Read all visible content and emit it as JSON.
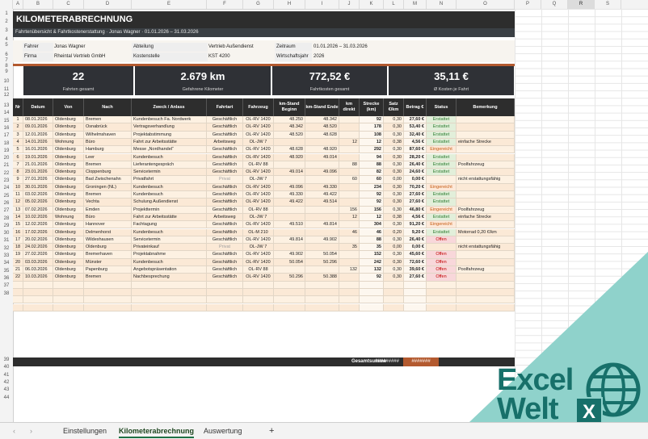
{
  "columns": [
    "A",
    "B",
    "C",
    "D",
    "E",
    "F",
    "G",
    "H",
    "I",
    "J",
    "K",
    "L",
    "M",
    "N",
    "O",
    "P",
    "Q",
    "R",
    "S"
  ],
  "selected_column": "R",
  "row_numbers": [
    "1",
    "2",
    "3",
    "4",
    "5",
    "6",
    "7",
    "8",
    "9",
    "10",
    "11",
    "12",
    "13",
    "14",
    "15",
    "16",
    "17",
    "18",
    "19",
    "20",
    "21",
    "22",
    "23",
    "24",
    "25",
    "26",
    "27",
    "28",
    "29",
    "30",
    "31",
    "32",
    "33",
    "34",
    "35",
    "36",
    "37",
    "38",
    "39",
    "40",
    "41",
    "42",
    "43",
    "44"
  ],
  "title": "KILOMETERABRECHNUNG",
  "subtitle": "Fahrtenübersicht & Fahrtkostenerstattung · Jonas Wagner · 01.01.2026 – 31.03.2026",
  "meta": {
    "fahrer_label": "Fahrer",
    "fahrer": "Jonas Wagner",
    "firma_label": "Firma",
    "firma": "Rheintal Vertrieb GmbH",
    "abteilung_label": "Abteilung",
    "abteilung": "Vertrieb Außendienst",
    "kostenstelle_label": "Kostenstelle",
    "kostenstelle": "KST 4200",
    "zeitraum_label": "Zeitraum",
    "zeitraum": "01.01.2026 – 31.03.2026",
    "wirtschaftsjahr_label": "Wirtschaftsjahr",
    "wirtschaftsjahr": "2026"
  },
  "kpis": [
    {
      "value": "22",
      "label": "Fahrten gesamt"
    },
    {
      "value": "2.679 km",
      "label": "Gefahrene Kilometer"
    },
    {
      "value": "772,52 €",
      "label": "Fahrtkosten gesamt"
    },
    {
      "value": "35,11 €",
      "label": "Ø Kosten je Fahrt"
    }
  ],
  "headers": [
    "Nr",
    "Datum",
    "Von",
    "Nach",
    "Zweck / Anlass",
    "Fahrtart",
    "Fahrzeug",
    "km-Stand Beginn",
    "km-Stand Ende",
    "km direkt",
    "Strecke (km)",
    "Satz €/km",
    "Betrag €",
    "Status",
    "Bemerkung"
  ],
  "rows": [
    [
      "1",
      "08.01.2026",
      "Oldenburg",
      "Bremen",
      "Kundenbesuch Fa. Nordwerk",
      "Geschäftlich",
      "OL-RV 1420",
      "48.250",
      "48.342",
      "",
      "92",
      "0,30",
      "27,60 €",
      "Erstattet",
      ""
    ],
    [
      "2",
      "09.01.2026",
      "Oldenburg",
      "Osnabrück",
      "Vertragsverhandlung",
      "Geschäftlich",
      "OL-RV 1420",
      "48.342",
      "48.520",
      "",
      "178",
      "0,30",
      "53,40 €",
      "Erstattet",
      ""
    ],
    [
      "3",
      "12.01.2026",
      "Oldenburg",
      "Wilhelmshaven",
      "Projektabstimmung",
      "Geschäftlich",
      "OL-RV 1420",
      "48.520",
      "48.628",
      "",
      "108",
      "0,30",
      "32,40 €",
      "Erstattet",
      ""
    ],
    [
      "4",
      "14.01.2026",
      "Wohnung",
      "Büro",
      "Fahrt zur Arbeitsstätte",
      "Arbeitsweg",
      "OL-JW 7",
      "",
      "",
      "12",
      "12",
      "0,38",
      "4,56 €",
      "Erstattet",
      "einfache Strecke"
    ],
    [
      "5",
      "16.01.2026",
      "Oldenburg",
      "Hamburg",
      "Messe „Nordhandel“",
      "Geschäftlich",
      "OL-RV 1420",
      "48.628",
      "48.920",
      "",
      "292",
      "0,30",
      "87,60 €",
      "Eingereicht",
      ""
    ],
    [
      "6",
      "19.01.2026",
      "Oldenburg",
      "Leer",
      "Kundenbesuch",
      "Geschäftlich",
      "OL-RV 1420",
      "48.920",
      "49.014",
      "",
      "94",
      "0,30",
      "28,20 €",
      "Erstattet",
      ""
    ],
    [
      "7",
      "21.01.2026",
      "Oldenburg",
      "Bremen",
      "Lieferantengespräch",
      "Geschäftlich",
      "OL-RV 88",
      "",
      "",
      "88",
      "88",
      "0,30",
      "26,40 €",
      "Erstattet",
      "Poolfahrzeug"
    ],
    [
      "8",
      "23.01.2026",
      "Oldenburg",
      "Cloppenburg",
      "Servicetermin",
      "Geschäftlich",
      "OL-RV 1420",
      "49.014",
      "49.096",
      "",
      "82",
      "0,30",
      "24,60 €",
      "Erstattet",
      ""
    ],
    [
      "9",
      "27.01.2026",
      "Oldenburg",
      "Bad Zwischenahn",
      "Privatfahrt",
      "Privat",
      "OL-JW 7",
      "",
      "",
      "60",
      "60",
      "0,00",
      "0,00 €",
      "",
      "nicht erstattungsfähig"
    ],
    [
      "10",
      "30.01.2026",
      "Oldenburg",
      "Groningen (NL)",
      "Kundenbesuch",
      "Geschäftlich",
      "OL-RV 1420",
      "49.096",
      "49.330",
      "",
      "234",
      "0,30",
      "70,20 €",
      "Eingereicht",
      ""
    ],
    [
      "11",
      "03.02.2026",
      "Oldenburg",
      "Bremen",
      "Kundenbesuch",
      "Geschäftlich",
      "OL-RV 1420",
      "49.330",
      "49.422",
      "",
      "92",
      "0,30",
      "27,60 €",
      "Erstattet",
      ""
    ],
    [
      "12",
      "05.02.2026",
      "Oldenburg",
      "Vechta",
      "Schulung Außendienst",
      "Geschäftlich",
      "OL-RV 1420",
      "49.422",
      "49.514",
      "",
      "92",
      "0,30",
      "27,60 €",
      "Erstattet",
      ""
    ],
    [
      "13",
      "07.02.2026",
      "Oldenburg",
      "Emden",
      "Projekttermin",
      "Geschäftlich",
      "OL-RV 88",
      "",
      "",
      "156",
      "156",
      "0,30",
      "46,80 €",
      "Eingereicht",
      "Poolfahrzeug"
    ],
    [
      "14",
      "10.02.2026",
      "Wohnung",
      "Büro",
      "Fahrt zur Arbeitsstätte",
      "Arbeitsweg",
      "OL-JW 7",
      "",
      "",
      "12",
      "12",
      "0,38",
      "4,56 €",
      "Erstattet",
      "einfache Strecke"
    ],
    [
      "15",
      "12.02.2026",
      "Oldenburg",
      "Hannover",
      "Fachtagung",
      "Geschäftlich",
      "OL-RV 1420",
      "49.510",
      "49.814",
      "",
      "304",
      "0,30",
      "91,20 €",
      "Eingereicht",
      ""
    ],
    [
      "16",
      "17.02.2026",
      "Oldenburg",
      "Delmenhorst",
      "Kundenbesuch",
      "Geschäftlich",
      "OL-M 210",
      "",
      "",
      "46",
      "46",
      "0,20",
      "9,20 €",
      "Erstattet",
      "Motorrad 0,20 €/km"
    ],
    [
      "17",
      "20.02.2026",
      "Oldenburg",
      "Wildeshausen",
      "Servicetermin",
      "Geschäftlich",
      "OL-RV 1420",
      "49.814",
      "49.902",
      "",
      "88",
      "0,30",
      "26,40 €",
      "Offen",
      ""
    ],
    [
      "18",
      "24.02.2026",
      "Oldenburg",
      "Oldenburg",
      "Privateinkauf",
      "Privat",
      "OL-JW 7",
      "",
      "",
      "35",
      "35",
      "0,00",
      "0,00 €",
      "",
      "nicht erstattungsfähig"
    ],
    [
      "19",
      "27.02.2026",
      "Oldenburg",
      "Bremerhaven",
      "Projektabnahme",
      "Geschäftlich",
      "OL-RV 1420",
      "49.902",
      "50.054",
      "",
      "152",
      "0,30",
      "45,60 €",
      "Offen",
      ""
    ],
    [
      "20",
      "03.03.2026",
      "Oldenburg",
      "Münster",
      "Kundenbesuch",
      "Geschäftlich",
      "OL-RV 1420",
      "50.054",
      "50.296",
      "",
      "242",
      "0,30",
      "72,60 €",
      "Offen",
      ""
    ],
    [
      "21",
      "06.03.2026",
      "Oldenburg",
      "Papenburg",
      "Angebotspräsentation",
      "Geschäftlich",
      "OL-RV 88",
      "",
      "",
      "132",
      "132",
      "0,30",
      "39,60 €",
      "Offen",
      "Poolfahrzeug"
    ],
    [
      "22",
      "10.03.2026",
      "Oldenburg",
      "Bremen",
      "Nachbesprechung",
      "Geschäftlich",
      "OL-RV 1420",
      "50.296",
      "50.388",
      "",
      "92",
      "0,30",
      "27,60 €",
      "Offen",
      ""
    ]
  ],
  "sum_label": "Gesamtsumme",
  "sum_km": "#########",
  "sum_betrag": "#######",
  "tabs": [
    "Einstellungen",
    "Kilometerabrechnung",
    "Auswertung"
  ],
  "active_tab": "Kilometerabrechnung",
  "add_sheet_label": "+",
  "logo": {
    "line1": "Excel",
    "line2": "Welt",
    "badge": "X"
  },
  "colors": {
    "header_dark": "#2d2d2d",
    "accent_rust": "#b35a2f",
    "row_fill": "#fdf1e2",
    "logo_teal": "#17706a",
    "deco_teal": "#8fd2cb"
  }
}
